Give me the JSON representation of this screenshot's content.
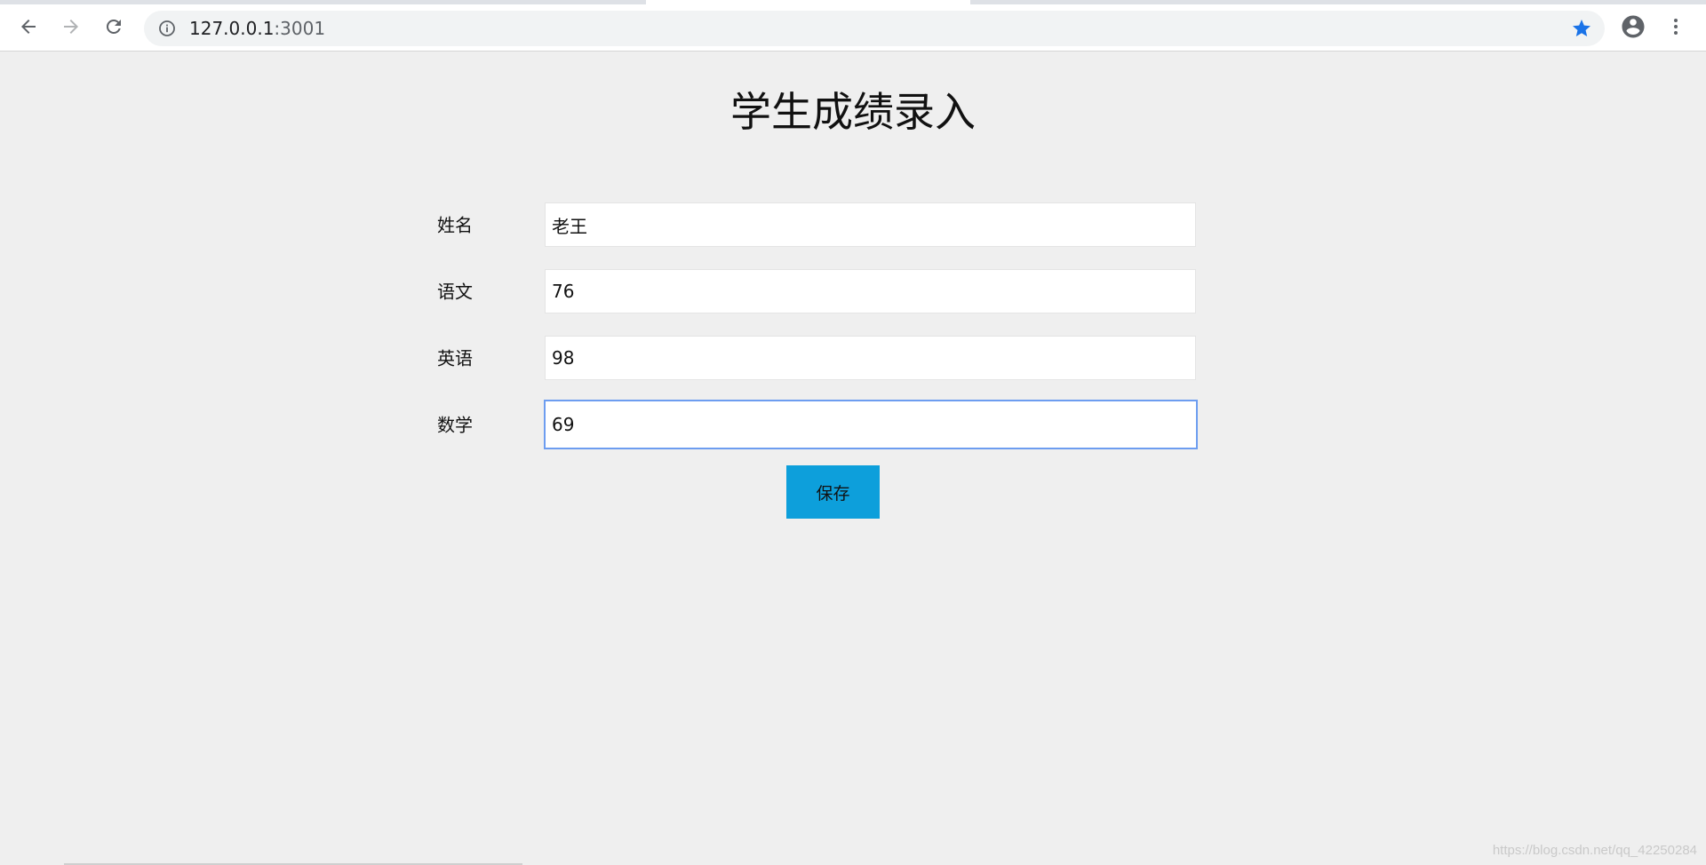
{
  "browser": {
    "url_host": "127.0.0.1",
    "url_port": ":3001",
    "icons": {
      "back": "back-arrow-icon",
      "forward": "forward-arrow-icon",
      "reload": "reload-icon",
      "info": "info-icon",
      "bookmark": "star-icon",
      "profile": "account-icon",
      "menu": "kebab-menu-icon"
    },
    "colors": {
      "bookmark_star": "#1a73e8",
      "profile_icon": "#5f6368"
    }
  },
  "page": {
    "title": "学生成绩录入",
    "background": "#efefef"
  },
  "form": {
    "fields": [
      {
        "label": "姓名",
        "value": "老王",
        "focused": false
      },
      {
        "label": "语文",
        "value": "76",
        "focused": false
      },
      {
        "label": "英语",
        "value": "98",
        "focused": false
      },
      {
        "label": "数学",
        "value": "69",
        "focused": true
      }
    ],
    "save_label": "保存",
    "save_color": "#0d9fdb",
    "focus_color": "#6d9df0"
  },
  "watermark": "https://blog.csdn.net/qq_42250284"
}
